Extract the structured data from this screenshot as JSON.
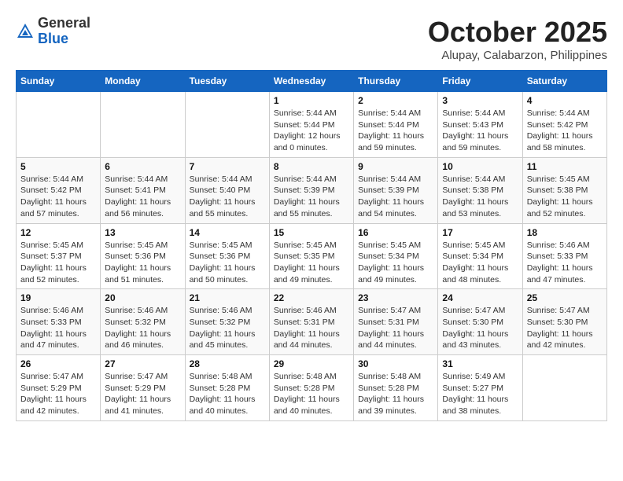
{
  "logo": {
    "general": "General",
    "blue": "Blue"
  },
  "title": "October 2025",
  "location": "Alupay, Calabarzon, Philippines",
  "days_of_week": [
    "Sunday",
    "Monday",
    "Tuesday",
    "Wednesday",
    "Thursday",
    "Friday",
    "Saturday"
  ],
  "weeks": [
    [
      {
        "day": "",
        "info": ""
      },
      {
        "day": "",
        "info": ""
      },
      {
        "day": "",
        "info": ""
      },
      {
        "day": "1",
        "info": "Sunrise: 5:44 AM\nSunset: 5:44 PM\nDaylight: 12 hours\nand 0 minutes."
      },
      {
        "day": "2",
        "info": "Sunrise: 5:44 AM\nSunset: 5:44 PM\nDaylight: 11 hours\nand 59 minutes."
      },
      {
        "day": "3",
        "info": "Sunrise: 5:44 AM\nSunset: 5:43 PM\nDaylight: 11 hours\nand 59 minutes."
      },
      {
        "day": "4",
        "info": "Sunrise: 5:44 AM\nSunset: 5:42 PM\nDaylight: 11 hours\nand 58 minutes."
      }
    ],
    [
      {
        "day": "5",
        "info": "Sunrise: 5:44 AM\nSunset: 5:42 PM\nDaylight: 11 hours\nand 57 minutes."
      },
      {
        "day": "6",
        "info": "Sunrise: 5:44 AM\nSunset: 5:41 PM\nDaylight: 11 hours\nand 56 minutes."
      },
      {
        "day": "7",
        "info": "Sunrise: 5:44 AM\nSunset: 5:40 PM\nDaylight: 11 hours\nand 55 minutes."
      },
      {
        "day": "8",
        "info": "Sunrise: 5:44 AM\nSunset: 5:39 PM\nDaylight: 11 hours\nand 55 minutes."
      },
      {
        "day": "9",
        "info": "Sunrise: 5:44 AM\nSunset: 5:39 PM\nDaylight: 11 hours\nand 54 minutes."
      },
      {
        "day": "10",
        "info": "Sunrise: 5:44 AM\nSunset: 5:38 PM\nDaylight: 11 hours\nand 53 minutes."
      },
      {
        "day": "11",
        "info": "Sunrise: 5:45 AM\nSunset: 5:38 PM\nDaylight: 11 hours\nand 52 minutes."
      }
    ],
    [
      {
        "day": "12",
        "info": "Sunrise: 5:45 AM\nSunset: 5:37 PM\nDaylight: 11 hours\nand 52 minutes."
      },
      {
        "day": "13",
        "info": "Sunrise: 5:45 AM\nSunset: 5:36 PM\nDaylight: 11 hours\nand 51 minutes."
      },
      {
        "day": "14",
        "info": "Sunrise: 5:45 AM\nSunset: 5:36 PM\nDaylight: 11 hours\nand 50 minutes."
      },
      {
        "day": "15",
        "info": "Sunrise: 5:45 AM\nSunset: 5:35 PM\nDaylight: 11 hours\nand 49 minutes."
      },
      {
        "day": "16",
        "info": "Sunrise: 5:45 AM\nSunset: 5:34 PM\nDaylight: 11 hours\nand 49 minutes."
      },
      {
        "day": "17",
        "info": "Sunrise: 5:45 AM\nSunset: 5:34 PM\nDaylight: 11 hours\nand 48 minutes."
      },
      {
        "day": "18",
        "info": "Sunrise: 5:46 AM\nSunset: 5:33 PM\nDaylight: 11 hours\nand 47 minutes."
      }
    ],
    [
      {
        "day": "19",
        "info": "Sunrise: 5:46 AM\nSunset: 5:33 PM\nDaylight: 11 hours\nand 47 minutes."
      },
      {
        "day": "20",
        "info": "Sunrise: 5:46 AM\nSunset: 5:32 PM\nDaylight: 11 hours\nand 46 minutes."
      },
      {
        "day": "21",
        "info": "Sunrise: 5:46 AM\nSunset: 5:32 PM\nDaylight: 11 hours\nand 45 minutes."
      },
      {
        "day": "22",
        "info": "Sunrise: 5:46 AM\nSunset: 5:31 PM\nDaylight: 11 hours\nand 44 minutes."
      },
      {
        "day": "23",
        "info": "Sunrise: 5:47 AM\nSunset: 5:31 PM\nDaylight: 11 hours\nand 44 minutes."
      },
      {
        "day": "24",
        "info": "Sunrise: 5:47 AM\nSunset: 5:30 PM\nDaylight: 11 hours\nand 43 minutes."
      },
      {
        "day": "25",
        "info": "Sunrise: 5:47 AM\nSunset: 5:30 PM\nDaylight: 11 hours\nand 42 minutes."
      }
    ],
    [
      {
        "day": "26",
        "info": "Sunrise: 5:47 AM\nSunset: 5:29 PM\nDaylight: 11 hours\nand 42 minutes."
      },
      {
        "day": "27",
        "info": "Sunrise: 5:47 AM\nSunset: 5:29 PM\nDaylight: 11 hours\nand 41 minutes."
      },
      {
        "day": "28",
        "info": "Sunrise: 5:48 AM\nSunset: 5:28 PM\nDaylight: 11 hours\nand 40 minutes."
      },
      {
        "day": "29",
        "info": "Sunrise: 5:48 AM\nSunset: 5:28 PM\nDaylight: 11 hours\nand 40 minutes."
      },
      {
        "day": "30",
        "info": "Sunrise: 5:48 AM\nSunset: 5:28 PM\nDaylight: 11 hours\nand 39 minutes."
      },
      {
        "day": "31",
        "info": "Sunrise: 5:49 AM\nSunset: 5:27 PM\nDaylight: 11 hours\nand 38 minutes."
      },
      {
        "day": "",
        "info": ""
      }
    ]
  ]
}
